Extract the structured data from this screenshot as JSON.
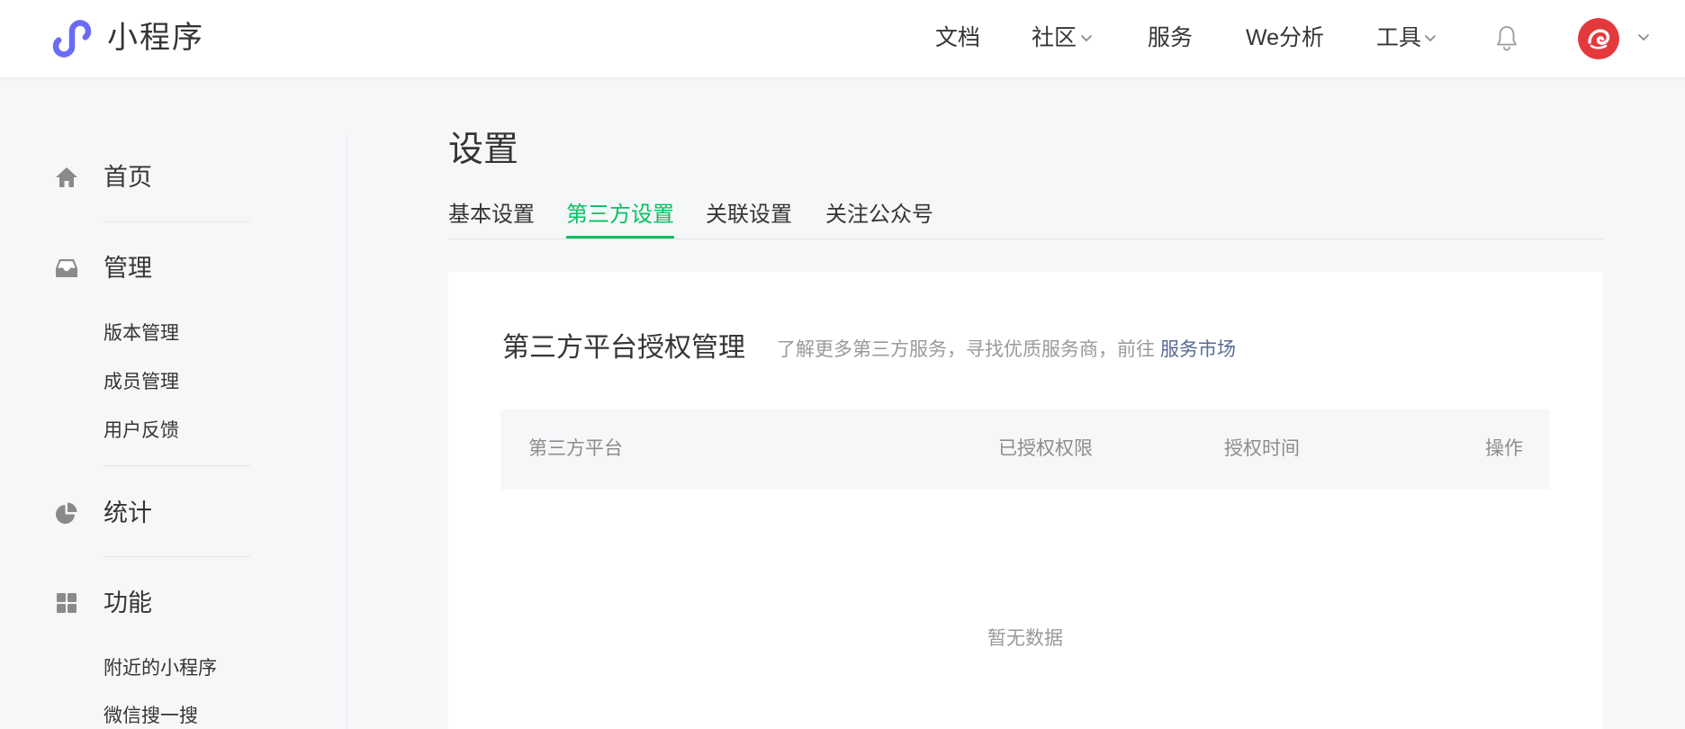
{
  "header": {
    "logo_text": "小程序",
    "logo_icon": "mini-program-logo-icon",
    "nav": [
      {
        "label": "文档",
        "dropdown": false
      },
      {
        "label": "社区",
        "dropdown": true
      },
      {
        "label": "服务",
        "dropdown": false
      },
      {
        "label": "We分析",
        "dropdown": false
      },
      {
        "label": "工具",
        "dropdown": true
      }
    ],
    "notification_icon": "bell-icon",
    "account_dropdown_icon": "chevron-down-icon"
  },
  "sidebar": {
    "sections": [
      {
        "label": "首页",
        "icon": "home-icon",
        "items": []
      },
      {
        "label": "管理",
        "icon": "inbox-icon",
        "items": [
          "版本管理",
          "成员管理",
          "用户反馈"
        ]
      },
      {
        "label": "统计",
        "icon": "pie-chart-icon",
        "items": []
      },
      {
        "label": "功能",
        "icon": "grid-icon",
        "items": [
          "附近的小程序",
          "微信搜一搜"
        ]
      }
    ]
  },
  "page": {
    "title": "设置",
    "tabs": [
      {
        "label": "基本设置",
        "active": false
      },
      {
        "label": "第三方设置",
        "active": true
      },
      {
        "label": "关联设置",
        "active": false
      },
      {
        "label": "关注公众号",
        "active": false
      }
    ]
  },
  "third_party_card": {
    "title": "第三方平台授权管理",
    "description": "了解更多第三方服务，寻找优质服务商，前往",
    "link_text": "服务市场",
    "table": {
      "columns": [
        "第三方平台",
        "已授权权限",
        "授权时间",
        "操作"
      ],
      "rows": [],
      "empty_text": "暂无数据"
    }
  },
  "colors": {
    "accent": "#07c160",
    "link": "#576b95",
    "logo": "#6a6cf6",
    "avatar": "#e4393c",
    "text": "#353535",
    "muted": "#9a9a9a",
    "page-bg": "#f6f7f9"
  }
}
